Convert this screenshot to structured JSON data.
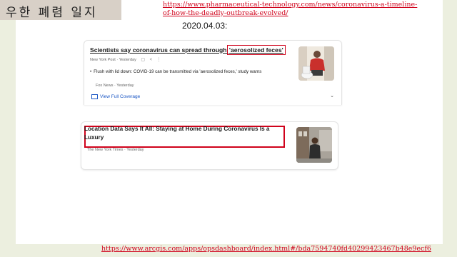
{
  "header": {
    "title": "우한 폐렴 일지",
    "source_link": "https://www.pharmaceutical-technology.com/news/coronavirus-a-timeline-of-how-the-deadly-outbreak-evolved/",
    "date": "2020.04.03:"
  },
  "card1": {
    "headline_prefix": "Scientists say coronavirus can spread through ",
    "headline_highlight": "'aerosolized feces'",
    "publisher": "New York Post",
    "time": "Yesterday",
    "related_headline": "Flush with lid down: COVID-19 can be transmitted via 'aerosolized feces,' study warns",
    "related_publisher": "Fox News",
    "related_time": "Yesterday",
    "full_coverage": "View Full Coverage"
  },
  "card2": {
    "headline": "Location Data Says It All: Staying at Home During Coronavirus Is a Luxury",
    "publisher": "The New York Times",
    "time": "Yesterday"
  },
  "footer": {
    "dashboard_link": "https://www.arcgis.com/apps/opsdashboard/index.html#/bda7594740fd40299423467b48e9ecf6"
  },
  "colors": {
    "highlight": "#d0021b",
    "link": "#d0021b",
    "coverage": "#1a56c4",
    "sidebar": "#ecefdf"
  }
}
